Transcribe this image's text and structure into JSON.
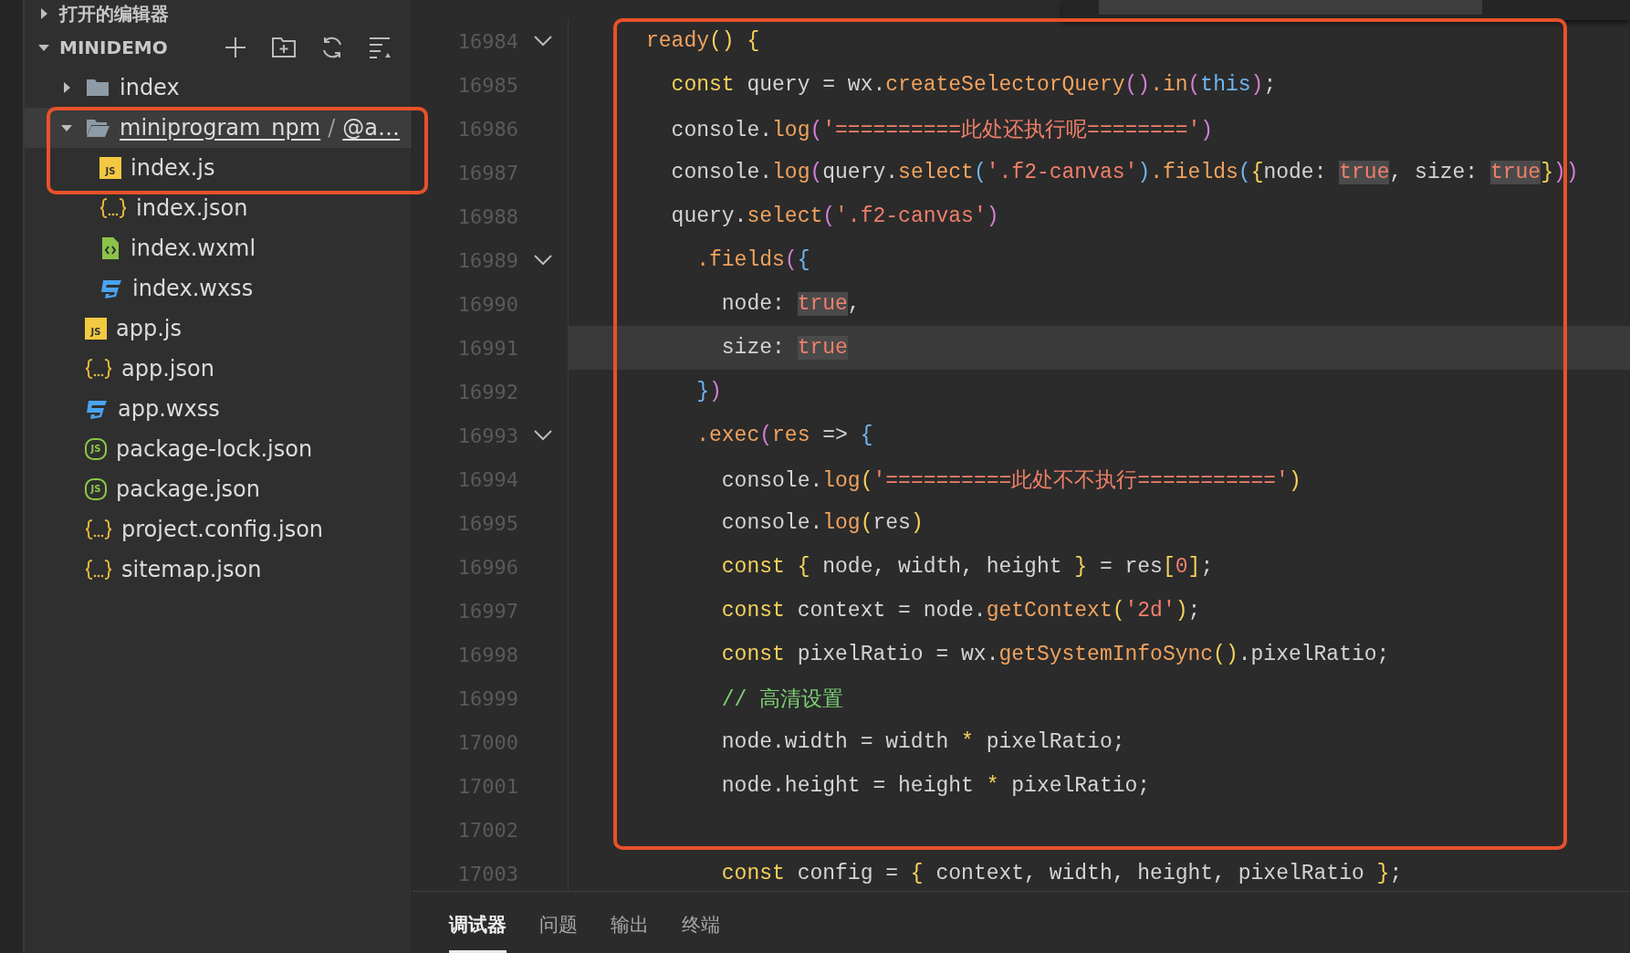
{
  "sidebar": {
    "sections": [
      {
        "title": "打开的编辑器",
        "expanded": false
      },
      {
        "title": "MINIDEMO",
        "expanded": true
      }
    ],
    "tree": [
      {
        "label": "index",
        "kind": "folder",
        "expanded": false,
        "selected": false
      },
      {
        "label": "miniprogram_npm",
        "separator": "/",
        "path_rest": "@a…",
        "kind": "folder",
        "expanded": true,
        "selected": true,
        "children": [
          {
            "label": "index.js",
            "kind": "js",
            "badge": "JS",
            "selected": false
          },
          {
            "label": "index.json",
            "kind": "json",
            "selected": false
          },
          {
            "label": "index.wxml",
            "kind": "wxml",
            "selected": false
          },
          {
            "label": "index.wxss",
            "kind": "wxss",
            "selected": false
          }
        ]
      },
      {
        "label": "app.js",
        "kind": "js",
        "badge": "JS",
        "selected": false
      },
      {
        "label": "app.json",
        "kind": "json",
        "selected": false
      },
      {
        "label": "app.wxss",
        "kind": "wxss",
        "selected": false
      },
      {
        "label": "package-lock.json",
        "kind": "node",
        "badge": "JS",
        "selected": false
      },
      {
        "label": "package.json",
        "kind": "node",
        "badge": "JS",
        "selected": false
      },
      {
        "label": "project.config.json",
        "kind": "json",
        "selected": false
      },
      {
        "label": "sitemap.json",
        "kind": "json",
        "selected": false
      }
    ]
  },
  "editor": {
    "lines": [
      {
        "number": "16984",
        "foldable": true,
        "current": false,
        "tokens": [
          {
            "kind": "fn",
            "text": "ready"
          },
          {
            "kind": "b1",
            "text": "() {"
          }
        ]
      },
      {
        "number": "16985",
        "foldable": false,
        "current": false,
        "tokens": [
          {
            "kind": "kw",
            "text": "  const"
          },
          {
            "kind": "pl",
            "text": " query = wx."
          },
          {
            "kind": "fn",
            "text": "createSelectorQuery"
          },
          {
            "kind": "b2",
            "text": "()"
          },
          {
            "kind": "fn",
            "text": ".in"
          },
          {
            "kind": "b2",
            "text": "("
          },
          {
            "kind": "this",
            "text": "this"
          },
          {
            "kind": "b2",
            "text": ")"
          },
          {
            "kind": "pl",
            "text": ";"
          }
        ]
      },
      {
        "number": "16986",
        "foldable": false,
        "current": false,
        "tokens": [
          {
            "kind": "pl",
            "text": "  console."
          },
          {
            "kind": "fn",
            "text": "log"
          },
          {
            "kind": "b2",
            "text": "("
          },
          {
            "kind": "str",
            "text": "'==========此处还执行呢========'"
          },
          {
            "kind": "b2",
            "text": ")"
          }
        ]
      },
      {
        "number": "16987",
        "foldable": false,
        "current": false,
        "tokens": [
          {
            "kind": "pl",
            "text": "  console."
          },
          {
            "kind": "fn",
            "text": "log"
          },
          {
            "kind": "b2",
            "text": "("
          },
          {
            "kind": "pl",
            "text": "query."
          },
          {
            "kind": "fn",
            "text": "select"
          },
          {
            "kind": "b3",
            "text": "("
          },
          {
            "kind": "str",
            "text": "'.f2-canvas'"
          },
          {
            "kind": "b3",
            "text": ")"
          },
          {
            "kind": "fn",
            "text": ".fields"
          },
          {
            "kind": "b3",
            "text": "("
          },
          {
            "kind": "b1",
            "text": "{"
          },
          {
            "kind": "pl",
            "text": "node: "
          },
          {
            "kind": "match",
            "text": "true"
          },
          {
            "kind": "pl",
            "text": ", size: "
          },
          {
            "kind": "match",
            "text": "true"
          },
          {
            "kind": "b1",
            "text": "}"
          },
          {
            "kind": "b2",
            "text": "))"
          }
        ]
      },
      {
        "number": "16988",
        "foldable": false,
        "current": false,
        "tokens": [
          {
            "kind": "pl",
            "text": "  query."
          },
          {
            "kind": "fn",
            "text": "select"
          },
          {
            "kind": "b2",
            "text": "("
          },
          {
            "kind": "str",
            "text": "'.f2-canvas'"
          },
          {
            "kind": "b2",
            "text": ")"
          }
        ]
      },
      {
        "number": "16989",
        "foldable": true,
        "current": false,
        "tokens": [
          {
            "kind": "fn",
            "text": "    .fields"
          },
          {
            "kind": "b2",
            "text": "("
          },
          {
            "kind": "b3",
            "text": "{"
          }
        ]
      },
      {
        "number": "16990",
        "foldable": false,
        "current": false,
        "tokens": [
          {
            "kind": "pl",
            "text": "      node: "
          },
          {
            "kind": "match",
            "text": "true"
          },
          {
            "kind": "pl",
            "text": ","
          }
        ]
      },
      {
        "number": "16991",
        "foldable": false,
        "current": true,
        "tokens": [
          {
            "kind": "pl",
            "text": "      size: "
          },
          {
            "kind": "match",
            "text": "true"
          }
        ]
      },
      {
        "number": "16992",
        "foldable": false,
        "current": false,
        "tokens": [
          {
            "kind": "b3",
            "text": "    }"
          },
          {
            "kind": "b2",
            "text": ")"
          }
        ]
      },
      {
        "number": "16993",
        "foldable": true,
        "current": false,
        "tokens": [
          {
            "kind": "fn",
            "text": "    .exec"
          },
          {
            "kind": "b2",
            "text": "("
          },
          {
            "kind": "fn",
            "text": "res"
          },
          {
            "kind": "pl",
            "text": " => "
          },
          {
            "kind": "b3",
            "text": "{"
          }
        ]
      },
      {
        "number": "16994",
        "foldable": false,
        "current": false,
        "tokens": [
          {
            "kind": "pl",
            "text": "      console."
          },
          {
            "kind": "fn",
            "text": "log"
          },
          {
            "kind": "b1",
            "text": "("
          },
          {
            "kind": "str",
            "text": "'==========此处不不执行==========='"
          },
          {
            "kind": "b1",
            "text": ")"
          }
        ]
      },
      {
        "number": "16995",
        "foldable": false,
        "current": false,
        "tokens": [
          {
            "kind": "pl",
            "text": "      console."
          },
          {
            "kind": "fn",
            "text": "log"
          },
          {
            "kind": "b1",
            "text": "("
          },
          {
            "kind": "pl",
            "text": "res"
          },
          {
            "kind": "b1",
            "text": ")"
          }
        ]
      },
      {
        "number": "16996",
        "foldable": false,
        "current": false,
        "tokens": [
          {
            "kind": "kw",
            "text": "      const"
          },
          {
            "kind": "b1",
            "text": " {"
          },
          {
            "kind": "pl",
            "text": " node, width, height "
          },
          {
            "kind": "b1",
            "text": "}"
          },
          {
            "kind": "pl",
            "text": " = res"
          },
          {
            "kind": "b1",
            "text": "["
          },
          {
            "kind": "num",
            "text": "0"
          },
          {
            "kind": "b1",
            "text": "]"
          },
          {
            "kind": "pl",
            "text": ";"
          }
        ]
      },
      {
        "number": "16997",
        "foldable": false,
        "current": false,
        "tokens": [
          {
            "kind": "kw",
            "text": "      const"
          },
          {
            "kind": "pl",
            "text": " context = node."
          },
          {
            "kind": "fn",
            "text": "getContext"
          },
          {
            "kind": "b1",
            "text": "("
          },
          {
            "kind": "str",
            "text": "'2d'"
          },
          {
            "kind": "b1",
            "text": ")"
          },
          {
            "kind": "pl",
            "text": ";"
          }
        ]
      },
      {
        "number": "16998",
        "foldable": false,
        "current": false,
        "tokens": [
          {
            "kind": "kw",
            "text": "      const"
          },
          {
            "kind": "pl",
            "text": " pixelRatio = wx."
          },
          {
            "kind": "fn",
            "text": "getSystemInfoSync"
          },
          {
            "kind": "b1",
            "text": "()"
          },
          {
            "kind": "pl",
            "text": ".pixelRatio;"
          }
        ]
      },
      {
        "number": "16999",
        "foldable": false,
        "current": false,
        "tokens": [
          {
            "kind": "cm",
            "text": "      // 高清设置"
          }
        ]
      },
      {
        "number": "17000",
        "foldable": false,
        "current": false,
        "tokens": [
          {
            "kind": "pl",
            "text": "      node.width = width "
          },
          {
            "kind": "kw",
            "text": "*"
          },
          {
            "kind": "pl",
            "text": " pixelRatio;"
          }
        ]
      },
      {
        "number": "17001",
        "foldable": false,
        "current": false,
        "tokens": [
          {
            "kind": "pl",
            "text": "      node.height = height "
          },
          {
            "kind": "kw",
            "text": "*"
          },
          {
            "kind": "pl",
            "text": " pixelRatio;"
          }
        ]
      },
      {
        "number": "17002",
        "foldable": false,
        "current": false
      },
      {
        "number": "17003",
        "foldable": false,
        "current": false,
        "tokens": [
          {
            "kind": "kw",
            "text": "      const"
          },
          {
            "kind": "pl",
            "text": " config = "
          },
          {
            "kind": "b1",
            "text": "{"
          },
          {
            "kind": "pl",
            "text": " context, width, height, pixelRatio "
          },
          {
            "kind": "b1",
            "text": "}"
          },
          {
            "kind": "pl",
            "text": ";"
          }
        ]
      }
    ]
  },
  "panel": {
    "tabs": [
      {
        "label": "调试器",
        "selected": true
      },
      {
        "label": "问题",
        "selected": false
      },
      {
        "label": "输出",
        "selected": false
      },
      {
        "label": "终端",
        "selected": false
      }
    ]
  }
}
